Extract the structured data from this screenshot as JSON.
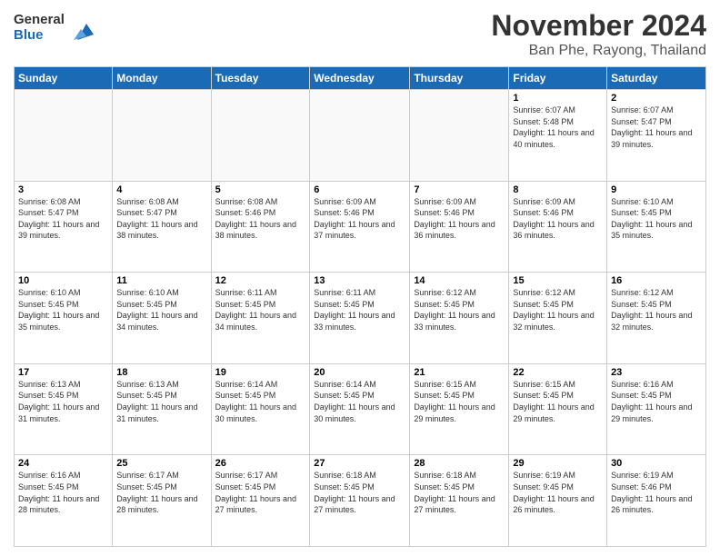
{
  "logo": {
    "line1": "General",
    "line2": "Blue"
  },
  "title": "November 2024",
  "subtitle": "Ban Phe, Rayong, Thailand",
  "days_header": [
    "Sunday",
    "Monday",
    "Tuesday",
    "Wednesday",
    "Thursday",
    "Friday",
    "Saturday"
  ],
  "weeks": [
    [
      {
        "day": "",
        "info": ""
      },
      {
        "day": "",
        "info": ""
      },
      {
        "day": "",
        "info": ""
      },
      {
        "day": "",
        "info": ""
      },
      {
        "day": "",
        "info": ""
      },
      {
        "day": "1",
        "info": "Sunrise: 6:07 AM\nSunset: 5:48 PM\nDaylight: 11 hours and 40 minutes."
      },
      {
        "day": "2",
        "info": "Sunrise: 6:07 AM\nSunset: 5:47 PM\nDaylight: 11 hours and 39 minutes."
      }
    ],
    [
      {
        "day": "3",
        "info": "Sunrise: 6:08 AM\nSunset: 5:47 PM\nDaylight: 11 hours and 39 minutes."
      },
      {
        "day": "4",
        "info": "Sunrise: 6:08 AM\nSunset: 5:47 PM\nDaylight: 11 hours and 38 minutes."
      },
      {
        "day": "5",
        "info": "Sunrise: 6:08 AM\nSunset: 5:46 PM\nDaylight: 11 hours and 38 minutes."
      },
      {
        "day": "6",
        "info": "Sunrise: 6:09 AM\nSunset: 5:46 PM\nDaylight: 11 hours and 37 minutes."
      },
      {
        "day": "7",
        "info": "Sunrise: 6:09 AM\nSunset: 5:46 PM\nDaylight: 11 hours and 36 minutes."
      },
      {
        "day": "8",
        "info": "Sunrise: 6:09 AM\nSunset: 5:46 PM\nDaylight: 11 hours and 36 minutes."
      },
      {
        "day": "9",
        "info": "Sunrise: 6:10 AM\nSunset: 5:45 PM\nDaylight: 11 hours and 35 minutes."
      }
    ],
    [
      {
        "day": "10",
        "info": "Sunrise: 6:10 AM\nSunset: 5:45 PM\nDaylight: 11 hours and 35 minutes."
      },
      {
        "day": "11",
        "info": "Sunrise: 6:10 AM\nSunset: 5:45 PM\nDaylight: 11 hours and 34 minutes."
      },
      {
        "day": "12",
        "info": "Sunrise: 6:11 AM\nSunset: 5:45 PM\nDaylight: 11 hours and 34 minutes."
      },
      {
        "day": "13",
        "info": "Sunrise: 6:11 AM\nSunset: 5:45 PM\nDaylight: 11 hours and 33 minutes."
      },
      {
        "day": "14",
        "info": "Sunrise: 6:12 AM\nSunset: 5:45 PM\nDaylight: 11 hours and 33 minutes."
      },
      {
        "day": "15",
        "info": "Sunrise: 6:12 AM\nSunset: 5:45 PM\nDaylight: 11 hours and 32 minutes."
      },
      {
        "day": "16",
        "info": "Sunrise: 6:12 AM\nSunset: 5:45 PM\nDaylight: 11 hours and 32 minutes."
      }
    ],
    [
      {
        "day": "17",
        "info": "Sunrise: 6:13 AM\nSunset: 5:45 PM\nDaylight: 11 hours and 31 minutes."
      },
      {
        "day": "18",
        "info": "Sunrise: 6:13 AM\nSunset: 5:45 PM\nDaylight: 11 hours and 31 minutes."
      },
      {
        "day": "19",
        "info": "Sunrise: 6:14 AM\nSunset: 5:45 PM\nDaylight: 11 hours and 30 minutes."
      },
      {
        "day": "20",
        "info": "Sunrise: 6:14 AM\nSunset: 5:45 PM\nDaylight: 11 hours and 30 minutes."
      },
      {
        "day": "21",
        "info": "Sunrise: 6:15 AM\nSunset: 5:45 PM\nDaylight: 11 hours and 29 minutes."
      },
      {
        "day": "22",
        "info": "Sunrise: 6:15 AM\nSunset: 5:45 PM\nDaylight: 11 hours and 29 minutes."
      },
      {
        "day": "23",
        "info": "Sunrise: 6:16 AM\nSunset: 5:45 PM\nDaylight: 11 hours and 29 minutes."
      }
    ],
    [
      {
        "day": "24",
        "info": "Sunrise: 6:16 AM\nSunset: 5:45 PM\nDaylight: 11 hours and 28 minutes."
      },
      {
        "day": "25",
        "info": "Sunrise: 6:17 AM\nSunset: 5:45 PM\nDaylight: 11 hours and 28 minutes."
      },
      {
        "day": "26",
        "info": "Sunrise: 6:17 AM\nSunset: 5:45 PM\nDaylight: 11 hours and 27 minutes."
      },
      {
        "day": "27",
        "info": "Sunrise: 6:18 AM\nSunset: 5:45 PM\nDaylight: 11 hours and 27 minutes."
      },
      {
        "day": "28",
        "info": "Sunrise: 6:18 AM\nSunset: 5:45 PM\nDaylight: 11 hours and 27 minutes."
      },
      {
        "day": "29",
        "info": "Sunrise: 6:19 AM\nSunset: 9:45 PM\nDaylight: 11 hours and 26 minutes."
      },
      {
        "day": "30",
        "info": "Sunrise: 6:19 AM\nSunset: 5:46 PM\nDaylight: 11 hours and 26 minutes."
      }
    ]
  ]
}
